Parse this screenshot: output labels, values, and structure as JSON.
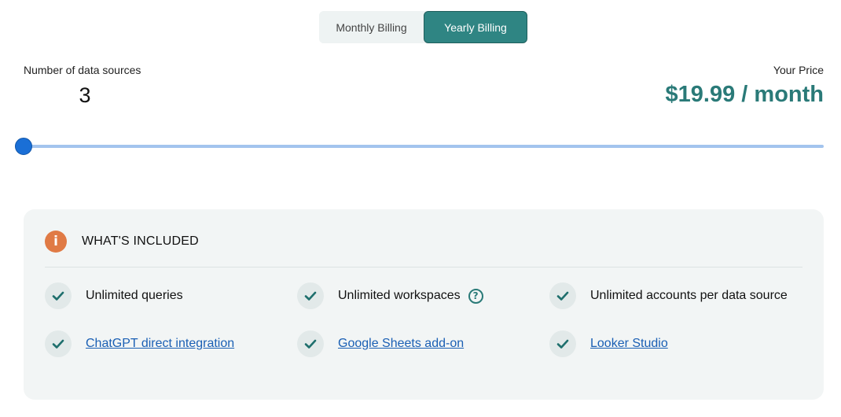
{
  "billing": {
    "monthly_label": "Monthly Billing",
    "yearly_label": "Yearly Billing",
    "selected": "yearly"
  },
  "data_sources": {
    "label": "Number of data sources",
    "value": "3"
  },
  "price": {
    "label": "Your Price",
    "value": "$19.99 / month"
  },
  "slider": {
    "current": 3,
    "fill_fraction": 0
  },
  "included": {
    "title": "WHAT'S INCLUDED",
    "icon": "info-icon",
    "features": [
      {
        "label": "Unlimited queries",
        "link": false
      },
      {
        "label": "Unlimited workspaces",
        "link": false,
        "help": "?"
      },
      {
        "label": "Unlimited accounts per data source",
        "link": false
      },
      {
        "label": "ChatGPT direct integration",
        "link": true
      },
      {
        "label": "Google Sheets add-on",
        "link": true
      },
      {
        "label": "Looker Studio",
        "link": true
      }
    ]
  },
  "colors": {
    "accent": "#2f8583",
    "price": "#2a7a78",
    "slider": "#1a6fd6",
    "info": "#e07a45",
    "link": "#1a5fb4"
  }
}
